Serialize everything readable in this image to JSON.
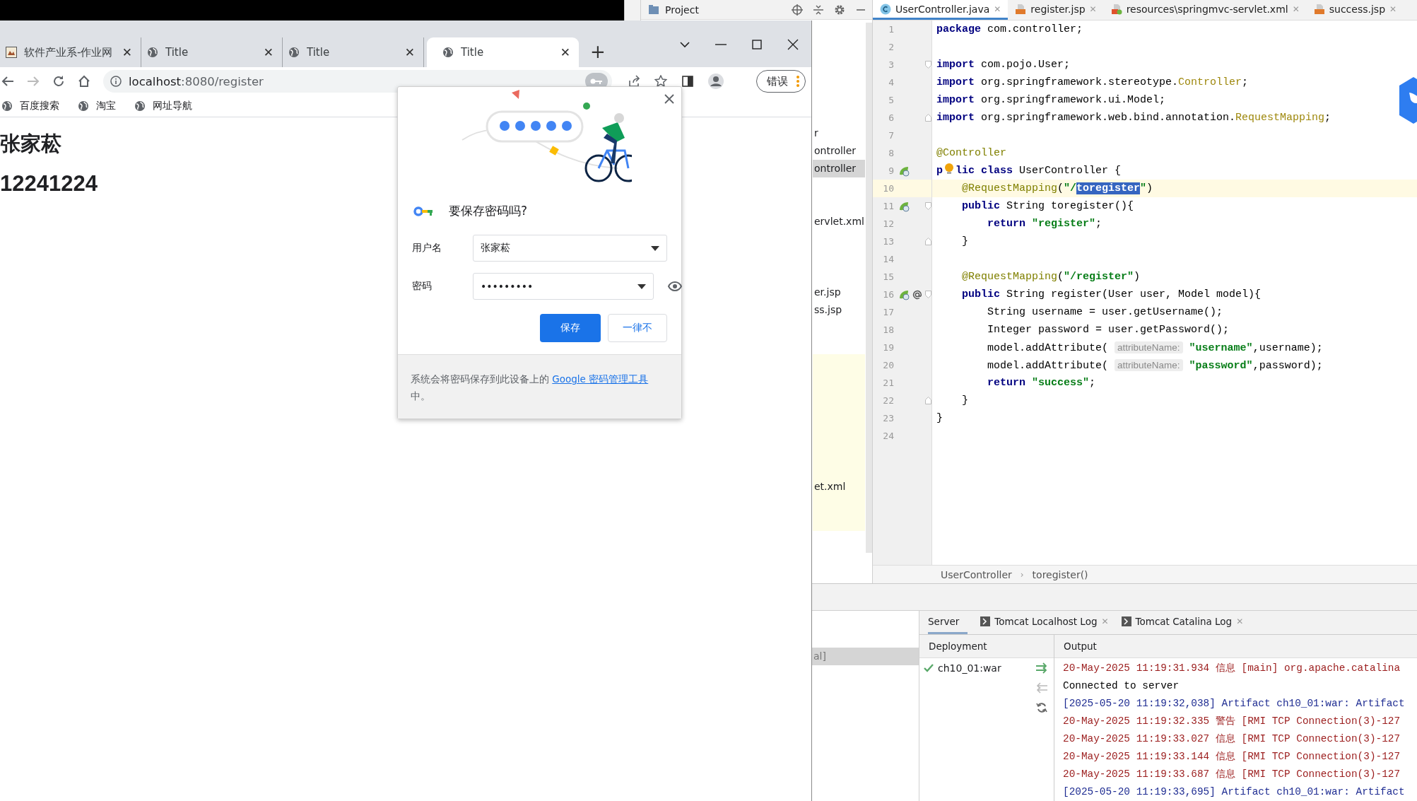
{
  "browser": {
    "tabs": [
      {
        "title": "软件产业系-作业网",
        "kind": "image",
        "close": "✕",
        "selected": false
      },
      {
        "title": "Title",
        "kind": "globe",
        "close": "✕",
        "selected": false
      },
      {
        "title": "Title",
        "kind": "globe",
        "close": "✕",
        "selected": false
      },
      {
        "title": "Title",
        "kind": "globe",
        "close": "✕",
        "selected": true
      }
    ],
    "new_tab": "+",
    "url_host": "localhost",
    "url_rest": ":8080/register",
    "profile_button": "错误",
    "bookmarks": [
      "百度搜索",
      "淘宝",
      "网址导航"
    ],
    "page": {
      "heading": "张家菘",
      "number": "12241224"
    }
  },
  "password_dialog": {
    "title": "要保存密码吗?",
    "fields": [
      {
        "label": "用户名",
        "value": "张家菘",
        "kind": "text"
      },
      {
        "label": "密码",
        "value": "•••••••••",
        "kind": "password"
      }
    ],
    "save_button": "保存",
    "never_button": "一律不",
    "footer_text": "系统会将密码保存到此设备上的 ",
    "footer_link": "Google 密码管理工具",
    "footer_suffix": "中。"
  },
  "ide": {
    "project_title": "Project",
    "tree": [
      {
        "text": "r",
        "selected": false
      },
      {
        "text": "ontroller",
        "selected": false
      },
      {
        "text": "ontroller",
        "selected": true
      },
      {
        "text": "ervlet.xml",
        "selected": false
      },
      {
        "text": "er.jsp",
        "selected": false
      },
      {
        "text": "ss.jsp",
        "selected": false
      },
      {
        "text": "et.xml",
        "selected": false
      }
    ],
    "editor_tabs": [
      {
        "title": "UserController.java",
        "kind": "java",
        "close": "✕",
        "selected": true
      },
      {
        "title": "register.jsp",
        "kind": "jsp",
        "close": "✕",
        "selected": false
      },
      {
        "title": "resources\\springmvc-servlet.xml",
        "kind": "xml",
        "close": "✕",
        "selected": false
      },
      {
        "title": "success.jsp",
        "kind": "jsp",
        "close": "✕",
        "selected": false
      }
    ],
    "code_lines": [
      {
        "number": "1",
        "tokens": [
          {
            "kind": "kw",
            "text": "package"
          },
          {
            "kind": "plain",
            "text": " com.controller;"
          }
        ]
      },
      {
        "number": "2"
      },
      {
        "number": "3",
        "fold": {
          "kind": "start"
        },
        "tokens": [
          {
            "kind": "kw",
            "text": "import"
          },
          {
            "kind": "plain",
            "text": " com.pojo.User;"
          }
        ]
      },
      {
        "number": "4",
        "tokens": [
          {
            "kind": "kw",
            "text": "import"
          },
          {
            "kind": "plain",
            "text": " org.springframework.stereotype."
          },
          {
            "kind": "cls",
            "text": "Controller"
          },
          {
            "kind": "plain",
            "text": ";"
          }
        ]
      },
      {
        "number": "5",
        "tokens": [
          {
            "kind": "kw",
            "text": "import"
          },
          {
            "kind": "plain",
            "text": " org.springframework.ui.Model;"
          }
        ]
      },
      {
        "number": "6",
        "fold": {
          "kind": "end"
        },
        "tokens": [
          {
            "kind": "kw",
            "text": "import"
          },
          {
            "kind": "plain",
            "text": " org.springframework.web.bind.annotation."
          },
          {
            "kind": "cls",
            "text": "RequestMapping"
          },
          {
            "kind": "plain",
            "text": ";"
          }
        ]
      },
      {
        "number": "7"
      },
      {
        "number": "8",
        "tokens": [
          {
            "kind": "ann",
            "text": "@Controller"
          }
        ]
      },
      {
        "number": "9",
        "gutter": [
          {
            "kind": "bean"
          }
        ],
        "tokens": [
          {
            "kind": "kw",
            "text": "p"
          },
          {
            "kind": "bulb"
          },
          {
            "kind": "kw",
            "text": "lic"
          },
          {
            "kind": "kw",
            "text": " class"
          },
          {
            "kind": "plain",
            "text": " UserController {"
          }
        ]
      },
      {
        "number": "10",
        "current": true,
        "tokens": [
          {
            "kind": "ann",
            "text": "    @RequestMapping"
          },
          {
            "kind": "plain",
            "text": "("
          },
          {
            "kind": "str",
            "text": "\"/"
          },
          {
            "kind": "sel",
            "text": "toregister"
          },
          {
            "kind": "str",
            "text": "\""
          },
          {
            "kind": "plain",
            "text": ")"
          }
        ]
      },
      {
        "number": "11",
        "gutter": [
          {
            "kind": "bean"
          }
        ],
        "fold": {
          "kind": "start"
        },
        "tokens": [
          {
            "kind": "kw",
            "text": "    public"
          },
          {
            "kind": "plain",
            "text": " String toregister(){"
          }
        ]
      },
      {
        "number": "12",
        "tokens": [
          {
            "kind": "kw",
            "text": "        return"
          },
          {
            "kind": "str",
            "text": " \"register\""
          },
          {
            "kind": "plain",
            "text": ";"
          }
        ]
      },
      {
        "number": "13",
        "fold": {
          "kind": "end"
        },
        "tokens": [
          {
            "kind": "plain",
            "text": "    }"
          }
        ]
      },
      {
        "number": "14"
      },
      {
        "number": "15",
        "tokens": [
          {
            "kind": "ann",
            "text": "    @RequestMapping"
          },
          {
            "kind": "plain",
            "text": "("
          },
          {
            "kind": "str",
            "text": "\"/register\""
          },
          {
            "kind": "plain",
            "text": ")"
          }
        ]
      },
      {
        "number": "16",
        "gutter": [
          {
            "kind": "bean"
          },
          {
            "kind": "at"
          }
        ],
        "fold": {
          "kind": "start"
        },
        "tokens": [
          {
            "kind": "kw",
            "text": "    public"
          },
          {
            "kind": "plain",
            "text": " String register(User user, Model model){"
          }
        ]
      },
      {
        "number": "17",
        "tokens": [
          {
            "kind": "plain",
            "text": "        String username = user.getUsername();"
          }
        ]
      },
      {
        "number": "18",
        "tokens": [
          {
            "kind": "plain",
            "text": "        Integer password = user.getPassword();"
          }
        ]
      },
      {
        "number": "19",
        "tokens": [
          {
            "kind": "plain",
            "text": "        model.addAttribute( "
          },
          {
            "kind": "hint",
            "text": "attributeName:"
          },
          {
            "kind": "str",
            "text": " \"username\""
          },
          {
            "kind": "plain",
            "text": ",username);"
          }
        ]
      },
      {
        "number": "20",
        "tokens": [
          {
            "kind": "plain",
            "text": "        model.addAttribute( "
          },
          {
            "kind": "hint",
            "text": "attributeName:"
          },
          {
            "kind": "str",
            "text": " \"password\""
          },
          {
            "kind": "plain",
            "text": ",password);"
          }
        ]
      },
      {
        "number": "21",
        "tokens": [
          {
            "kind": "kw",
            "text": "        return"
          },
          {
            "kind": "str",
            "text": " \"success\""
          },
          {
            "kind": "plain",
            "text": ";"
          }
        ]
      },
      {
        "number": "22",
        "fold": {
          "kind": "end"
        },
        "tokens": [
          {
            "kind": "plain",
            "text": "    }"
          }
        ]
      },
      {
        "number": "23",
        "tokens": [
          {
            "kind": "plain",
            "text": "}"
          }
        ]
      },
      {
        "number": "24"
      }
    ],
    "breadcrumb": [
      "UserController",
      "toregister()"
    ],
    "breadcrumb_separator": "›",
    "services_fragment": {
      "text": "al]",
      "selected": true
    },
    "run_tabs": [
      {
        "title": "Server",
        "kind": "plain",
        "selected": true
      },
      {
        "title": "Tomcat Localhost Log",
        "kind": "log",
        "close": "✕",
        "selected": false
      },
      {
        "title": "Tomcat Catalina Log",
        "kind": "log",
        "close": "✕",
        "selected": false
      }
    ],
    "deployment_header": "Deployment",
    "output_header": "Output",
    "deployments": [
      {
        "name": "ch10_01:war",
        "ok": true
      }
    ],
    "log_lines": [
      {
        "text": "20-May-2025 11:19:31.934 信息 [main] org.apache.catalina",
        "kind": "server"
      },
      {
        "text": "Connected to server",
        "kind": "plain"
      },
      {
        "text": "[2025-05-20 11:19:32,038] Artifact ch10_01:war: Artifact",
        "kind": "artifact"
      },
      {
        "text": "20-May-2025 11:19:32.335 警告 [RMI TCP Connection(3)-127",
        "kind": "server"
      },
      {
        "text": "20-May-2025 11:19:33.027 信息 [RMI TCP Connection(3)-127",
        "kind": "server"
      },
      {
        "text": "20-May-2025 11:19:33.144 信息 [RMI TCP Connection(3)-127",
        "kind": "server"
      },
      {
        "text": "20-May-2025 11:19:33.687 信息 [RMI TCP Connection(3)-127",
        "kind": "server"
      },
      {
        "text": "[2025-05-20 11:19:33,695] Artifact ch10_01:war: Artifact",
        "kind": "artifact"
      }
    ]
  }
}
